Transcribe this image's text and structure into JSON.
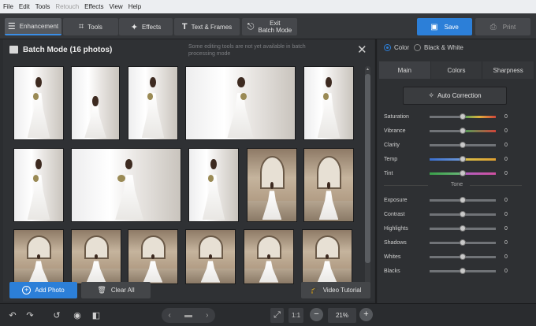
{
  "menu": [
    "File",
    "Edit",
    "Tools",
    "Retouch",
    "Effects",
    "View",
    "Help"
  ],
  "menu_disabled": [
    "Retouch"
  ],
  "toolbar": {
    "enhancement": "Enhancement",
    "tools": "Tools",
    "effects": "Effects",
    "text_frames": "Text & Frames",
    "exit_line1": "Exit",
    "exit_line2": "Batch Mode",
    "save": "Save",
    "print": "Print",
    "icons": {
      "enhancement": "sliders-icon",
      "tools": "crop-icon",
      "effects": "magic-wand-icon",
      "text_frames": "text-icon",
      "exit": "exit-batch-icon",
      "save": "save-icon",
      "print": "printer-icon"
    }
  },
  "batch": {
    "title": "Batch Mode (16 photos)",
    "note": "Some editing tools are not yet available in batch processing mode",
    "photos_count": 16
  },
  "actions": {
    "add_photo": "Add Photo",
    "clear_all": "Clear All",
    "video_tutorial": "Video Tutorial"
  },
  "status": {
    "zoom_fit": "1:1",
    "zoom": "21%"
  },
  "right": {
    "mode_color": "Color",
    "mode_bw": "Black & White",
    "tabs": [
      "Main",
      "Colors",
      "Sharpness"
    ],
    "auto_correction": "Auto Correction",
    "sliders_top": [
      {
        "label": "Saturation",
        "value": "0"
      },
      {
        "label": "Vibrance",
        "value": "0"
      },
      {
        "label": "Clarity",
        "value": "0"
      },
      {
        "label": "Temp",
        "value": "0"
      },
      {
        "label": "Tint",
        "value": "0"
      }
    ],
    "tone_label": "Tone",
    "sliders_tone": [
      {
        "label": "Exposure",
        "value": "0"
      },
      {
        "label": "Contrast",
        "value": "0"
      },
      {
        "label": "Highlights",
        "value": "0"
      },
      {
        "label": "Shadows",
        "value": "0"
      },
      {
        "label": "Whites",
        "value": "0"
      },
      {
        "label": "Blacks",
        "value": "0"
      }
    ]
  },
  "colors": {
    "accent": "#2c7fd8",
    "panel": "#2f3134",
    "toolbar": "#35373a"
  }
}
